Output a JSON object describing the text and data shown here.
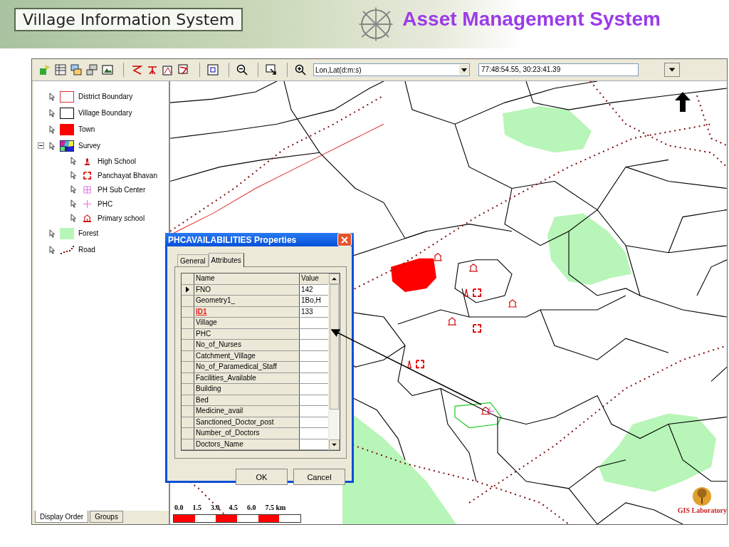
{
  "banner": {
    "title": "Village Information System",
    "subtitle": "Asset Management System"
  },
  "toolbar": {
    "coordinate_system": "Lon,Lat(d:m:s)",
    "coordinates": "77:48:54.55, 30:23:41.39"
  },
  "legend": {
    "items": [
      {
        "label": "District Boundary",
        "kind": "outline",
        "color": "#e03030"
      },
      {
        "label": "Village Boundary",
        "kind": "outline",
        "color": "#000000"
      },
      {
        "label": "Town",
        "kind": "fill",
        "color": "#ff0000"
      },
      {
        "label": "Survey",
        "kind": "survey",
        "expanded": true,
        "children": [
          {
            "label": "High School",
            "kind": "tower",
            "color": "#d01010"
          },
          {
            "label": "Panchayat Bhavan",
            "kind": "frame",
            "color": "#e01010"
          },
          {
            "label": "PH Sub Center",
            "kind": "grid",
            "color": "#e060e0"
          },
          {
            "label": "PHC",
            "kind": "plus",
            "color": "#e060e0"
          },
          {
            "label": "Primary school",
            "kind": "house",
            "color": "#d01010"
          }
        ]
      },
      {
        "label": "Forest",
        "kind": "fill",
        "color": "#b8f5b8"
      },
      {
        "label": "Road",
        "kind": "road",
        "color": "#801010"
      }
    ]
  },
  "legend_tabs": [
    {
      "label": "Display Order",
      "selected": true
    },
    {
      "label": "Groups",
      "selected": false
    }
  ],
  "dialog": {
    "title": "PHCAVAILABILITIES Properties",
    "tabs": [
      {
        "label": "General",
        "selected": false
      },
      {
        "label": "Attributes",
        "selected": true
      }
    ],
    "columns": [
      "Name",
      "Value"
    ],
    "rows": [
      {
        "name": "FNO",
        "value": "142",
        "selected": true,
        "key": false
      },
      {
        "name": "Geometry1_",
        "value": "1Bo,H",
        "selected": false,
        "key": false
      },
      {
        "name": "ID1",
        "value": "133",
        "selected": false,
        "key": true
      },
      {
        "name": "Village",
        "selected": false,
        "key": false
      },
      {
        "name": "PHC",
        "selected": false,
        "key": false
      },
      {
        "name": "No_of_Nurses",
        "selected": false,
        "key": false
      },
      {
        "name": "Catchment_Village",
        "selected": false,
        "key": false
      },
      {
        "name": "No_of_Paramedical_Staff",
        "selected": false,
        "key": false
      },
      {
        "name": "Facilities_Available",
        "selected": false,
        "key": false
      },
      {
        "name": "Building",
        "selected": false,
        "key": false
      },
      {
        "name": "Bed",
        "selected": false,
        "key": false
      },
      {
        "name": "Medicine_avail",
        "selected": false,
        "key": false
      },
      {
        "name": "Sanctioned_Doctor_post",
        "selected": false,
        "key": false
      },
      {
        "name": "Number_of_Doctors",
        "selected": false,
        "key": false
      },
      {
        "name": "Doctors_Name",
        "selected": false,
        "key": false
      }
    ],
    "buttons": [
      "OK",
      "Cancel"
    ]
  },
  "scale_bar": {
    "labels": [
      "0.0",
      "1.5",
      "3.0",
      "4.5",
      "6.0",
      "7.5 km"
    ]
  },
  "logo": {
    "caption": "GIS Laboratory"
  }
}
